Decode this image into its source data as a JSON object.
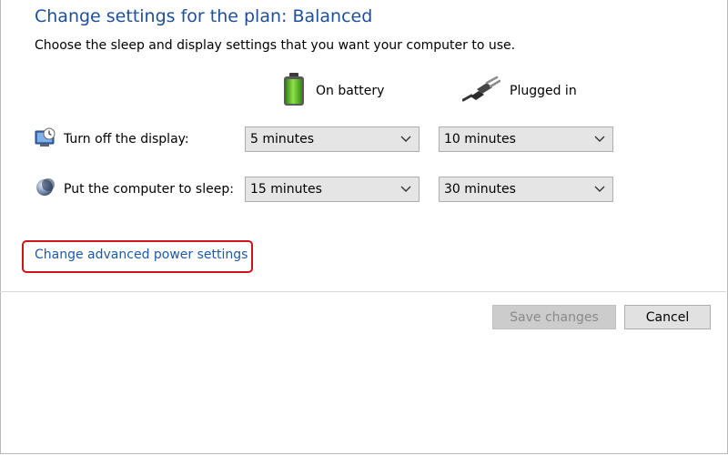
{
  "header": {
    "title": "Change settings for the plan: Balanced",
    "subtitle": "Choose the sleep and display settings that you want your computer to use."
  },
  "columns": {
    "battery": {
      "label": "On battery",
      "icon": "battery-icon"
    },
    "plugged": {
      "label": "Plugged in",
      "icon": "power-plug-icon"
    }
  },
  "rows": {
    "display": {
      "label": "Turn off the display:",
      "icon": "display-timer-icon",
      "battery_value": "5 minutes",
      "plugged_value": "10 minutes"
    },
    "sleep": {
      "label": "Put the computer to sleep:",
      "icon": "sleep-moon-icon",
      "battery_value": "15 minutes",
      "plugged_value": "30 minutes"
    }
  },
  "links": {
    "advanced": "Change advanced power settings"
  },
  "buttons": {
    "save": "Save changes",
    "save_enabled": false,
    "cancel": "Cancel"
  },
  "colors": {
    "title": "#1e4f9c",
    "link": "#1e5aa8",
    "highlight": "#d0131b",
    "battery": "#4caf1e"
  }
}
